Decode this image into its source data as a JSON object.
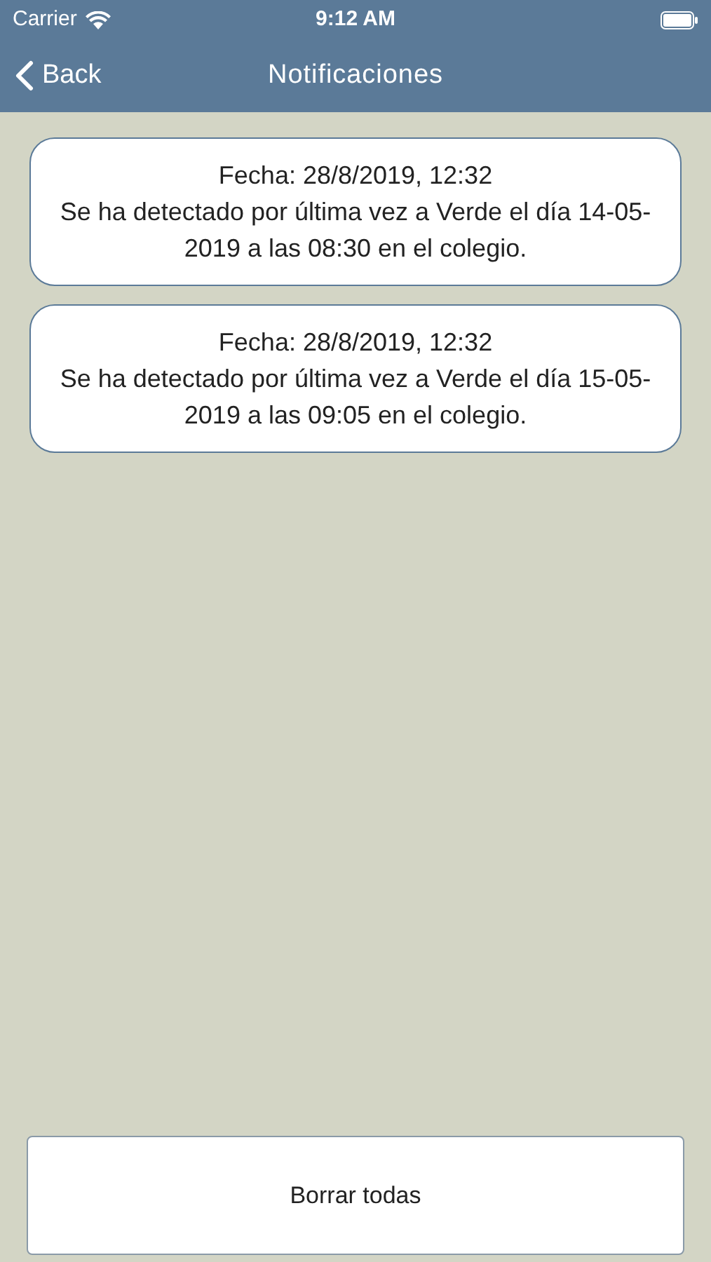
{
  "status_bar": {
    "carrier": "Carrier",
    "time": "9:12 AM"
  },
  "nav": {
    "back": "Back",
    "title": "Notificaciones"
  },
  "notifications": [
    {
      "date": "Fecha: 28/8/2019, 12:32",
      "message": "Se ha detectado por última vez a Verde el día 14-05-2019 a las 08:30 en el colegio."
    },
    {
      "date": "Fecha: 28/8/2019, 12:32",
      "message": "Se ha detectado por última vez a Verde el día 15-05-2019 a las 09:05 en el colegio."
    }
  ],
  "delete_all_button": "Borrar todas"
}
